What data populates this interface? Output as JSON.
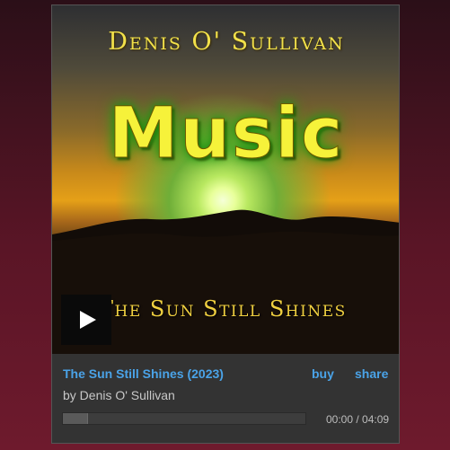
{
  "artwork": {
    "artist_text": "Denis O' Sullivan",
    "headline_text": "Music",
    "song_text": "The Sun Still Shines"
  },
  "player": {
    "play_icon": "play-icon",
    "track_title": "The Sun Still Shines (2023)",
    "buy_label": "buy",
    "share_label": "share",
    "by_line": "by Denis O' Sullivan",
    "time_display": "00:00 / 04:09",
    "progress_fraction": 0
  },
  "colors": {
    "link": "#4aa3e8",
    "panel": "#333333",
    "background": "#5a1526"
  }
}
